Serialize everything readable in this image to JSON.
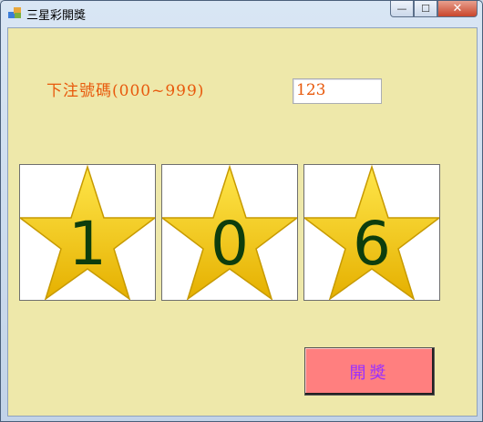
{
  "window": {
    "title": "三星彩開獎",
    "controls": {
      "minimize": "—",
      "maximize": "☐",
      "close": "✕"
    }
  },
  "form": {
    "bet_label": "下注號碼(000~999)",
    "bet_value": "123",
    "draw_button_label": "開獎"
  },
  "stars": [
    {
      "digit": "1",
      "icon": "star-icon"
    },
    {
      "digit": "0",
      "icon": "star-icon"
    },
    {
      "digit": "6",
      "icon": "star-icon"
    }
  ],
  "colors": {
    "form_background": "#eee8aa",
    "label_text": "#e8590c",
    "digit_text": "#0d3d0d",
    "button_background": "#ff7f7f",
    "button_text": "#9b30ff",
    "star_fill": "#f5c400"
  }
}
